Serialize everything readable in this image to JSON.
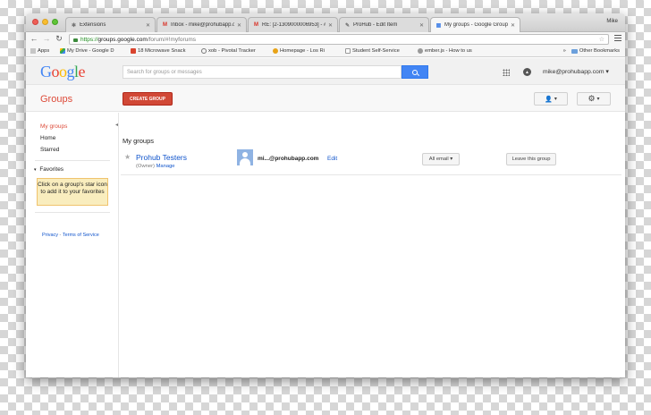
{
  "browser": {
    "profile_name": "Mike",
    "tabs": [
      {
        "title": "Extensions",
        "icon": "puzzle-icon",
        "color": "#777777"
      },
      {
        "title": "Inbox - mike@prohubapp.c",
        "icon": "gmail-icon",
        "color": "#d93025"
      },
      {
        "title": "RE: [2-1309000006953] - #",
        "icon": "gmail-icon",
        "color": "#d93025"
      },
      {
        "title": "ProHub - Edit Item",
        "icon": "pencil-icon",
        "color": "#777777"
      },
      {
        "title": "My groups - Google Group",
        "icon": "groups-icon",
        "color": "#4a86e8"
      }
    ],
    "url": {
      "scheme": "https://",
      "host": "groups.google.com",
      "path": "/forum/#!myforums"
    },
    "bookmarks": [
      {
        "label": "Apps",
        "icon": "apps-icon"
      },
      {
        "label": "My Drive - Google D",
        "icon": "drive-icon"
      },
      {
        "label": "18 Microwave Snack",
        "icon": "bookmark-red-icon"
      },
      {
        "label": "xob - Pivotal Tracker",
        "icon": "pivotal-icon"
      },
      {
        "label": "Homepage - Los Ri",
        "icon": "homepage-icon"
      },
      {
        "label": "Student Self-Service",
        "icon": "page-icon"
      },
      {
        "label": "ember.js - How to us",
        "icon": "ember-icon"
      }
    ],
    "bookmarks_overflow": "»",
    "other_bookmarks": "Other Bookmarks"
  },
  "google_bar": {
    "logo_letters": [
      "G",
      "o",
      "o",
      "g",
      "l",
      "e"
    ],
    "logo_colors": [
      "#4285f4",
      "#ea4335",
      "#fbbc05",
      "#4285f4",
      "#34a853",
      "#ea4335"
    ],
    "search_placeholder": "Search for groups or messages",
    "account": "mike@prohubapp.com ▾"
  },
  "groups_bar": {
    "title": "Groups",
    "create_label": "CREATE GROUP",
    "people_label": "▾",
    "settings_label": "▾"
  },
  "sidebar": {
    "items": [
      {
        "label": "My groups",
        "active": true
      },
      {
        "label": "Home",
        "active": false
      },
      {
        "label": "Starred",
        "active": false
      }
    ],
    "favorites_heading": "Favorites",
    "favorites_hint": "Click on a group's star icon to add it to your favorites",
    "privacy": "Privacy",
    "separator": " - ",
    "terms": "Terms of Service"
  },
  "main": {
    "title": "My groups",
    "groups": [
      {
        "name": "Prohub Testers",
        "role": "(Owner)",
        "manage": "Manage",
        "email": "mi...@prohubapp.com",
        "edit": "Edit",
        "email_setting": "All email ▾",
        "leave": "Leave this group"
      }
    ]
  }
}
